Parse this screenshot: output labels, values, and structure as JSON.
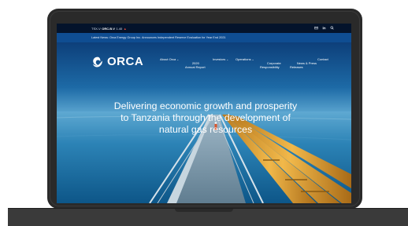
{
  "topbar": {
    "exchange": "TSX-V",
    "ticker": "ORC.B.V",
    "price": "1.40",
    "change": "▲",
    "icons": [
      "mail-icon",
      "linkedin-icon",
      "search-icon"
    ]
  },
  "newsbar": {
    "text": "Latest News: Orca Energy Group Inc. Announces Independent Reserve Evaluation for Year End 2021"
  },
  "brand": {
    "name": "ORCA",
    "logo_icon": "orca-logo-icon"
  },
  "nav": {
    "items": [
      {
        "label": "About Orca",
        "has_dropdown": true
      },
      {
        "label": "2020\nAnnual Report",
        "has_dropdown": false
      },
      {
        "label": "Investors",
        "has_dropdown": true
      },
      {
        "label": "Operations",
        "has_dropdown": true
      },
      {
        "label": "Corporate\nResponsibility",
        "has_dropdown": true
      },
      {
        "label": "News & Press\nReleases",
        "has_dropdown": false
      },
      {
        "label": "Contact",
        "has_dropdown": false
      }
    ]
  },
  "hero": {
    "headline_lines": [
      "Delivering economic growth and prosperity",
      "to Tanzania through the development of",
      "natural gas resources"
    ]
  },
  "colors": {
    "topbar": "#04132b",
    "newsbar": "#0f4d92",
    "pipes": "#e7a636",
    "accent_change": "#e54a3a"
  }
}
